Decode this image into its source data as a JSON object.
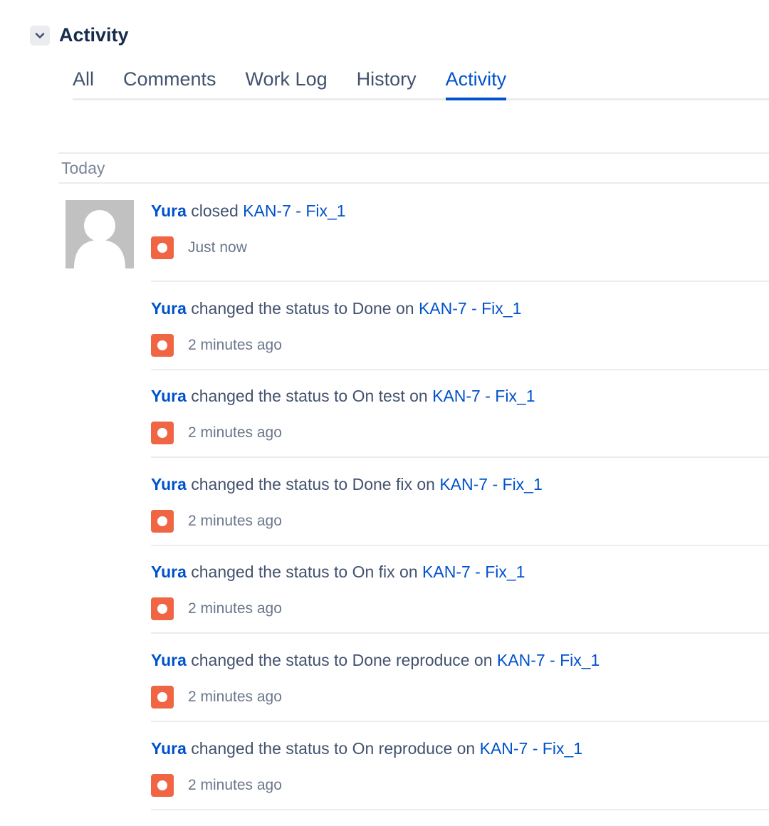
{
  "section": {
    "title": "Activity"
  },
  "tabs": [
    {
      "label": "All"
    },
    {
      "label": "Comments"
    },
    {
      "label": "Work Log"
    },
    {
      "label": "History"
    },
    {
      "label": "Activity"
    }
  ],
  "active_tab": "Activity",
  "date_group": "Today",
  "accent_color": "#0052cc",
  "status_icon_color": "#f06543",
  "activities": [
    {
      "actor": "Yura",
      "action": " closed ",
      "issue": "KAN-7 - Fix_1",
      "time": "Just now"
    },
    {
      "actor": "Yura",
      "action": " changed the status to Done on ",
      "issue": "KAN-7 - Fix_1",
      "time": "2 minutes ago"
    },
    {
      "actor": "Yura",
      "action": " changed the status to On test on ",
      "issue": "KAN-7 - Fix_1",
      "time": "2 minutes ago"
    },
    {
      "actor": "Yura",
      "action": " changed the status to Done fix on ",
      "issue": "KAN-7 - Fix_1",
      "time": "2 minutes ago"
    },
    {
      "actor": "Yura",
      "action": " changed the status to On fix on ",
      "issue": "KAN-7 - Fix_1",
      "time": "2 minutes ago"
    },
    {
      "actor": "Yura",
      "action": " changed the status to Done reproduce on ",
      "issue": "KAN-7 - Fix_1",
      "time": "2 minutes ago"
    },
    {
      "actor": "Yura",
      "action": " changed the status to On reproduce on ",
      "issue": "KAN-7 - Fix_1",
      "time": "2 minutes ago"
    }
  ]
}
